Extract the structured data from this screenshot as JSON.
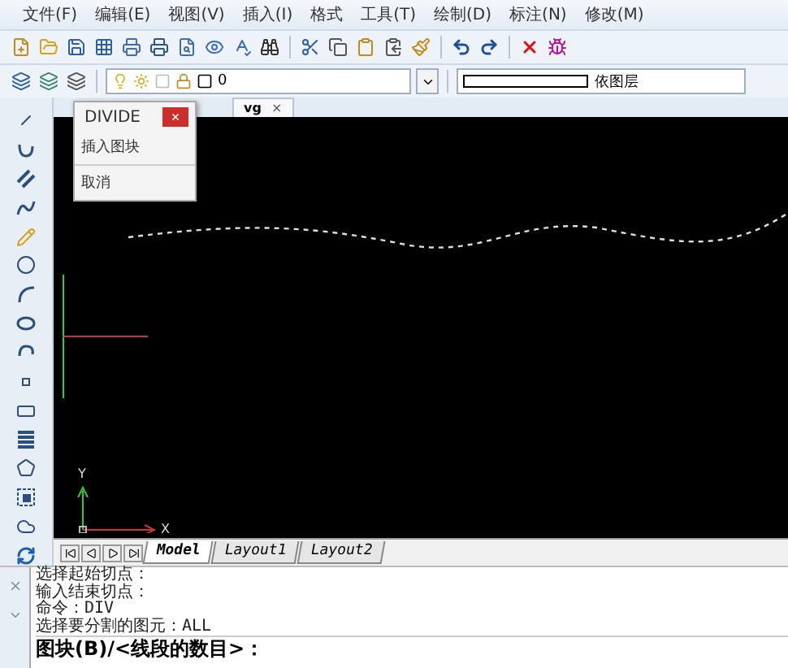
{
  "menu_bar": {
    "items": [
      "文件(F)",
      "编辑(E)",
      "视图(V)",
      "插入(I)",
      "格式",
      "工具(T)",
      "绘制(D)",
      "标注(N)",
      "修改(M)"
    ]
  },
  "layer_toolbar": {
    "layer": "0",
    "linetype": "依图层"
  },
  "drawing_tab": {
    "label": "vg",
    "close": "×"
  },
  "context_menu": {
    "title": "DIVIDE",
    "close": "×",
    "items": [
      "插入图块",
      "取消"
    ]
  },
  "canvas": {
    "y_label": "Y",
    "x_label": "X"
  },
  "layout_tabs": [
    {
      "label": "Model",
      "selected": true
    },
    {
      "label": "Layout1",
      "selected": false
    },
    {
      "label": "Layout2",
      "selected": false
    }
  ],
  "command_history": [
    "选择起始切点：",
    "输入结束切点：",
    "命令：DIV",
    "选择要分割的图元：ALL"
  ],
  "command_prompt": "图块(B)/<线段的数目>："
}
